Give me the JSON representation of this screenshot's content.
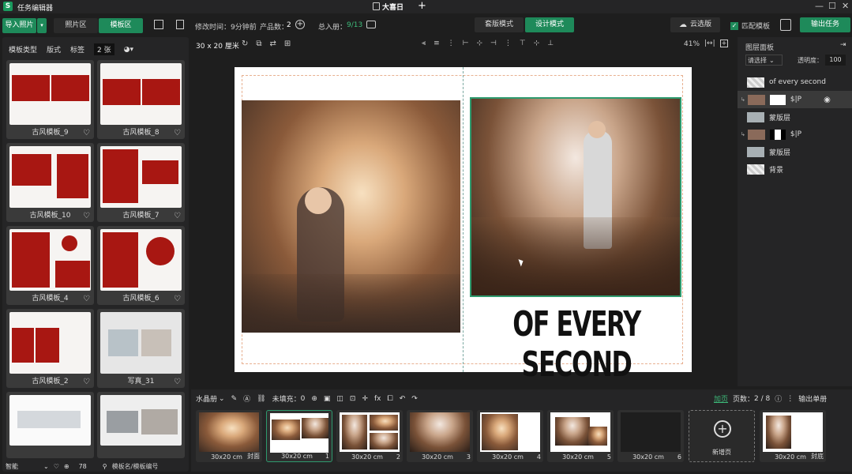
{
  "window": {
    "app_title": "任务编辑器",
    "doc_title": "大喜日",
    "min": "—",
    "max": "☐",
    "close": "✕"
  },
  "toolbar": {
    "import_photos": "导入照片",
    "tab_photos": "照片区",
    "tab_templates": "模板区",
    "modified_label": "修改时间：9分钟前",
    "product_count_label": "产品数：",
    "product_count": "2",
    "total_label": "总入册：",
    "total_value": "9/13",
    "mode_template": "套版模式",
    "mode_design": "设计模式",
    "cloud_template": "云选版",
    "match_template": "匹配模板",
    "output_task": "输出任务"
  },
  "filters": {
    "type": "模板类型",
    "layout": "版式",
    "tags": "标签",
    "count": "2 张"
  },
  "templates": [
    {
      "name": "古风模板_9"
    },
    {
      "name": "古风模板_8"
    },
    {
      "name": "古风模板_10"
    },
    {
      "name": "古风模板_7"
    },
    {
      "name": "古风模板_4"
    },
    {
      "name": "古风模板_6"
    },
    {
      "name": "古风模板_2"
    },
    {
      "name": "写真_31"
    },
    {
      "name": ""
    },
    {
      "name": ""
    }
  ],
  "left_footer": {
    "smart": "智能",
    "zoom": "78",
    "search_placeholder": "模板名/模板编号"
  },
  "canvas": {
    "size": "30 x 20 厘米",
    "zoom": "41%",
    "headline": "OF EVERY SECOND"
  },
  "layers": {
    "title": "图层面板",
    "select": "请选择",
    "opacity_label": "透明度：",
    "opacity": "100",
    "items": [
      {
        "name": "of every second"
      },
      {
        "name": "$|P"
      },
      {
        "name": "蒙版层"
      },
      {
        "name": "$|P"
      },
      {
        "name": "蒙版层"
      },
      {
        "name": "背景"
      }
    ]
  },
  "bottom": {
    "album": "水晶册",
    "unfilled_label": "未填充：",
    "unfilled": "0",
    "add_page": "加页",
    "pages_label": "页数：",
    "pages": "2 / 8",
    "output_single": "输出单册",
    "pages_list": [
      {
        "size": "30x20 cm",
        "num": "封面"
      },
      {
        "size": "30x20 cm",
        "num": "1"
      },
      {
        "size": "30x20 cm",
        "num": "2"
      },
      {
        "size": "30x20 cm",
        "num": "3"
      },
      {
        "size": "30x20 cm",
        "num": "4"
      },
      {
        "size": "30x20 cm",
        "num": "5"
      },
      {
        "size": "30x20 cm",
        "num": "6"
      },
      {
        "size": "新增页",
        "num": ""
      },
      {
        "size": "30x20 cm",
        "num": "封底"
      }
    ]
  },
  "colors": {
    "accent": "#1e8a5a",
    "template_red": "#a81712",
    "selection": "#2e9a6e"
  }
}
